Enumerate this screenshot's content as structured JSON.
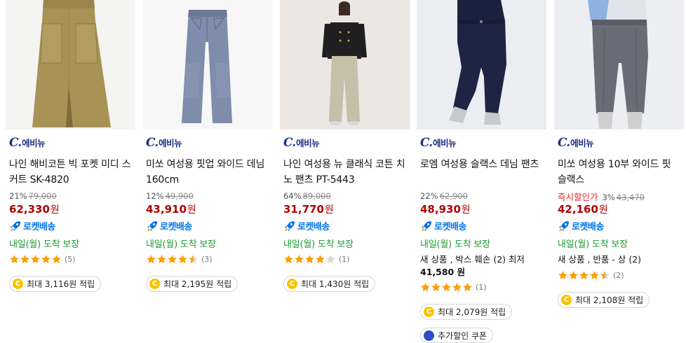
{
  "brand": {
    "mark": "C.",
    "text": "에비뉴"
  },
  "colors": {
    "brand": "#1a2f80",
    "price": "#ae0000",
    "rocket": "#0073e9",
    "arrival": "#1b9a2f",
    "star": "#ff9c00",
    "instant_discount": "#e52528"
  },
  "products": [
    {
      "title": "나인 해비코튼 빅 포켓 미디 스커트 SK-4820",
      "discount": "21%",
      "original_price": "79,000",
      "instant_label": "",
      "price": "62,330",
      "price_unit": "원",
      "delivery": "로켓배송",
      "arrival": "내일(월) 도착 보장",
      "extra_line": "",
      "extra_bold": "",
      "rating": 5,
      "review_count": "(5)",
      "reward": "최대 3,116원 적립",
      "coupon": ""
    },
    {
      "title": "미쏘 여성용 핏업 와이드 데님 160cm",
      "discount": "12%",
      "original_price": "49,900",
      "instant_label": "",
      "price": "43,910",
      "price_unit": "원",
      "delivery": "로켓배송",
      "arrival": "내일(월) 도착 보장",
      "extra_line": "",
      "extra_bold": "",
      "rating": 4.5,
      "review_count": "(3)",
      "reward": "최대 2,195원 적립",
      "coupon": ""
    },
    {
      "title": "나인 여성용 뉴 클래식 코튼 치노 팬츠 PT-5443",
      "discount": "64%",
      "original_price": "89,000",
      "instant_label": "",
      "price": "31,770",
      "price_unit": "원",
      "delivery": "로켓배송",
      "arrival": "내일(월) 도착 보장",
      "extra_line": "",
      "extra_bold": "",
      "rating": 4,
      "review_count": "(1)",
      "reward": "최대 1,430원 적립",
      "coupon": ""
    },
    {
      "title": "로엠 여성용 슬랙스 데님 팬츠",
      "discount": "22%",
      "original_price": "62,900",
      "instant_label": "",
      "price": "48,930",
      "price_unit": "원",
      "delivery": "로켓배송",
      "arrival": "내일(월) 도착 보장",
      "extra_line": "새 상품 , 박스 훼손 (2) 최저",
      "extra_bold": "41,580 원",
      "rating": 5,
      "review_count": "(1)",
      "reward": "최대 2,079원 적립",
      "coupon": "추가할인 쿠폰"
    },
    {
      "title": "미쏘 여성용 10부 와이드 핏 슬랙스",
      "discount": "3%",
      "original_price": "43,470",
      "instant_label": "즉시할인가",
      "price": "42,160",
      "price_unit": "원",
      "delivery": "로켓배송",
      "arrival": "내일(월) 도착 보장",
      "extra_line": "새 상품 , 반품 - 상 (2)",
      "extra_bold": "",
      "rating": 4.5,
      "review_count": "(2)",
      "reward": "최대 2,108원 적립",
      "coupon": ""
    }
  ]
}
